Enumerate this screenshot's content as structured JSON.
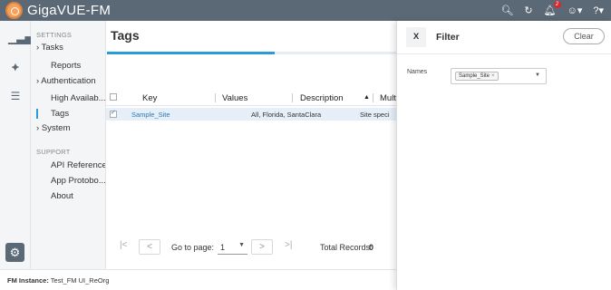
{
  "app": {
    "title": "GigaVUE-FM"
  },
  "topbar": {
    "notification_count": "2"
  },
  "nav": {
    "settings_label": "SETTINGS",
    "items": [
      {
        "label": "Tasks",
        "prefix": "›"
      },
      {
        "label": "Reports",
        "prefix": ""
      },
      {
        "label": "Authentication",
        "prefix": "›"
      },
      {
        "label": "High Availab...",
        "prefix": ""
      },
      {
        "label": "Tags",
        "prefix": ""
      },
      {
        "label": "System",
        "prefix": "›"
      }
    ],
    "support_label": "SUPPORT",
    "support_items": [
      {
        "label": "API Reference"
      },
      {
        "label": "App Protobo..."
      },
      {
        "label": "About"
      }
    ]
  },
  "main": {
    "title": "Tags",
    "progress_fraction": 0.58,
    "table": {
      "headers": {
        "key": "Key",
        "values": "Values",
        "description": "Description",
        "multi": "Multi"
      },
      "rows": [
        {
          "key": "Sample_Site",
          "values": "All, Florida, SantaClara",
          "multi": "Site speci",
          "checked": true
        }
      ]
    },
    "pager": {
      "first": "|<",
      "prev": "<",
      "goto_label": "Go to page:",
      "page_value": "1",
      "next": ">",
      "last": ">|",
      "total_label": "Total Records:",
      "total_value": "0"
    }
  },
  "footer": {
    "label": "FM Instance:",
    "value": "Test_FM UI_ReOrg"
  },
  "filter": {
    "close_label": "X",
    "title": "Filter",
    "clear_label": "Clear",
    "field_label": "Names",
    "chip_value": "Sample_Site",
    "chip_remove": "×"
  },
  "colors": {
    "topbar": "#5b6875",
    "accent": "#2a9bd6",
    "badge": "#d9262e"
  }
}
